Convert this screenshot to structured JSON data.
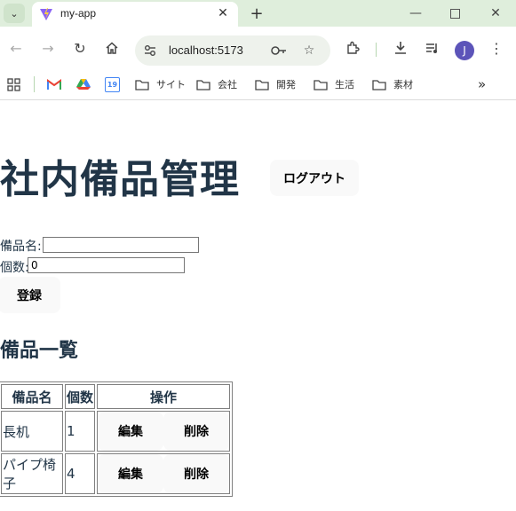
{
  "browser": {
    "tab_title": "my-app",
    "url": "localhost:5173",
    "profile_initial": "J",
    "calendar_day": "19",
    "bookmarks": [
      {
        "label": "サイト"
      },
      {
        "label": "会社"
      },
      {
        "label": "開発"
      },
      {
        "label": "生活"
      },
      {
        "label": "素材"
      }
    ]
  },
  "app": {
    "title": "社内備品管理",
    "logout_label": "ログアウト",
    "form": {
      "name_label": "備品名:",
      "name_value": "",
      "count_label": "個数:",
      "count_value": "0",
      "submit_label": "登録"
    },
    "list_title": "備品一覧",
    "table": {
      "headers": [
        "備品名",
        "個数",
        "操作"
      ],
      "rows": [
        {
          "name": "長机",
          "count": "1",
          "edit_label": "編集",
          "delete_label": "削除"
        },
        {
          "name": "パイプ椅子",
          "count": "4",
          "edit_label": "編集",
          "delete_label": "削除"
        }
      ]
    }
  }
}
